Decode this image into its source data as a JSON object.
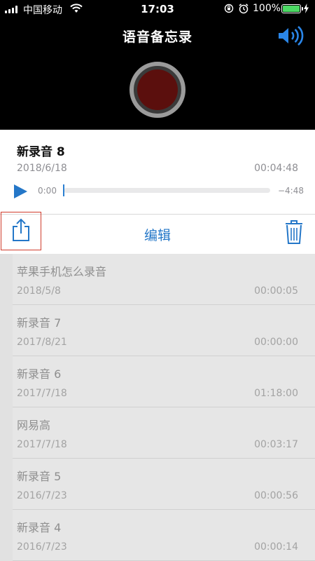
{
  "status_bar": {
    "carrier": "中国移动",
    "time": "17:03",
    "battery": "100%"
  },
  "header": {
    "title": "语音备忘录"
  },
  "current_recording": {
    "title": "新录音 8",
    "date": "2018/6/18",
    "duration": "00:04:48",
    "elapsed": "0:00",
    "remaining": "−4:48",
    "progress": 0.0
  },
  "toolbar": {
    "edit_label": "编辑"
  },
  "recordings": [
    {
      "title": "苹果手机怎么录音",
      "date": "2018/5/8",
      "duration": "00:00:05"
    },
    {
      "title": "新录音 7",
      "date": "2017/8/21",
      "duration": "00:00:00"
    },
    {
      "title": "新录音 6",
      "date": "2017/7/18",
      "duration": "01:18:00"
    },
    {
      "title": "网易高",
      "date": "2017/7/18",
      "duration": "00:03:17"
    },
    {
      "title": "新录音 5",
      "date": "2016/7/23",
      "duration": "00:00:56"
    },
    {
      "title": "新录音 4",
      "date": "2016/7/23",
      "duration": "00:00:14"
    }
  ],
  "icons": {
    "speaker": "speaker-volume-icon",
    "record": "record-icon",
    "play": "play-icon",
    "share": "share-icon",
    "trash": "trash-icon"
  },
  "colors": {
    "accent": "#2477c8",
    "record": "#5b0f0d",
    "highlight_box": "#d03c2c",
    "battery": "#4cd964"
  }
}
